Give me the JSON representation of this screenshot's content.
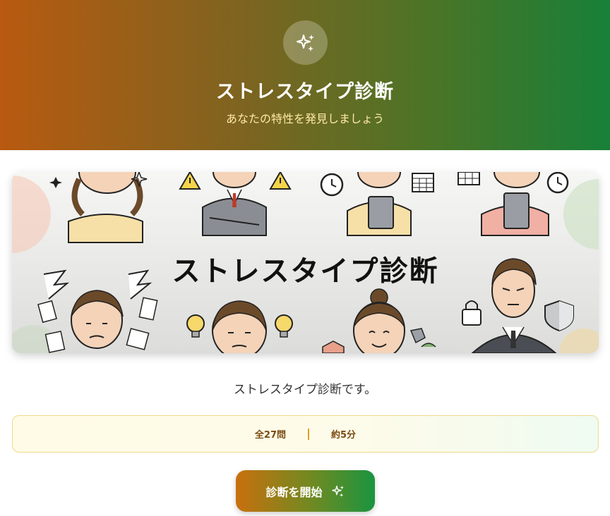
{
  "header": {
    "icon": "sparkles-icon",
    "title": "ストレスタイプ診断",
    "subtitle": "あなたの特性を発見しましょう"
  },
  "banner": {
    "title": "ストレスタイプ診断"
  },
  "description": "ストレスタイプ診断です。",
  "info": {
    "questions": "全27問",
    "duration": "約5分"
  },
  "start_button": {
    "label": "診断を開始",
    "icon": "sparkles-icon"
  },
  "colors": {
    "header_left": "#b85a10",
    "header_right": "#178038",
    "subtitle": "#ffe9a8",
    "info_text": "#7a4a10",
    "info_separator": "#e0a020"
  }
}
